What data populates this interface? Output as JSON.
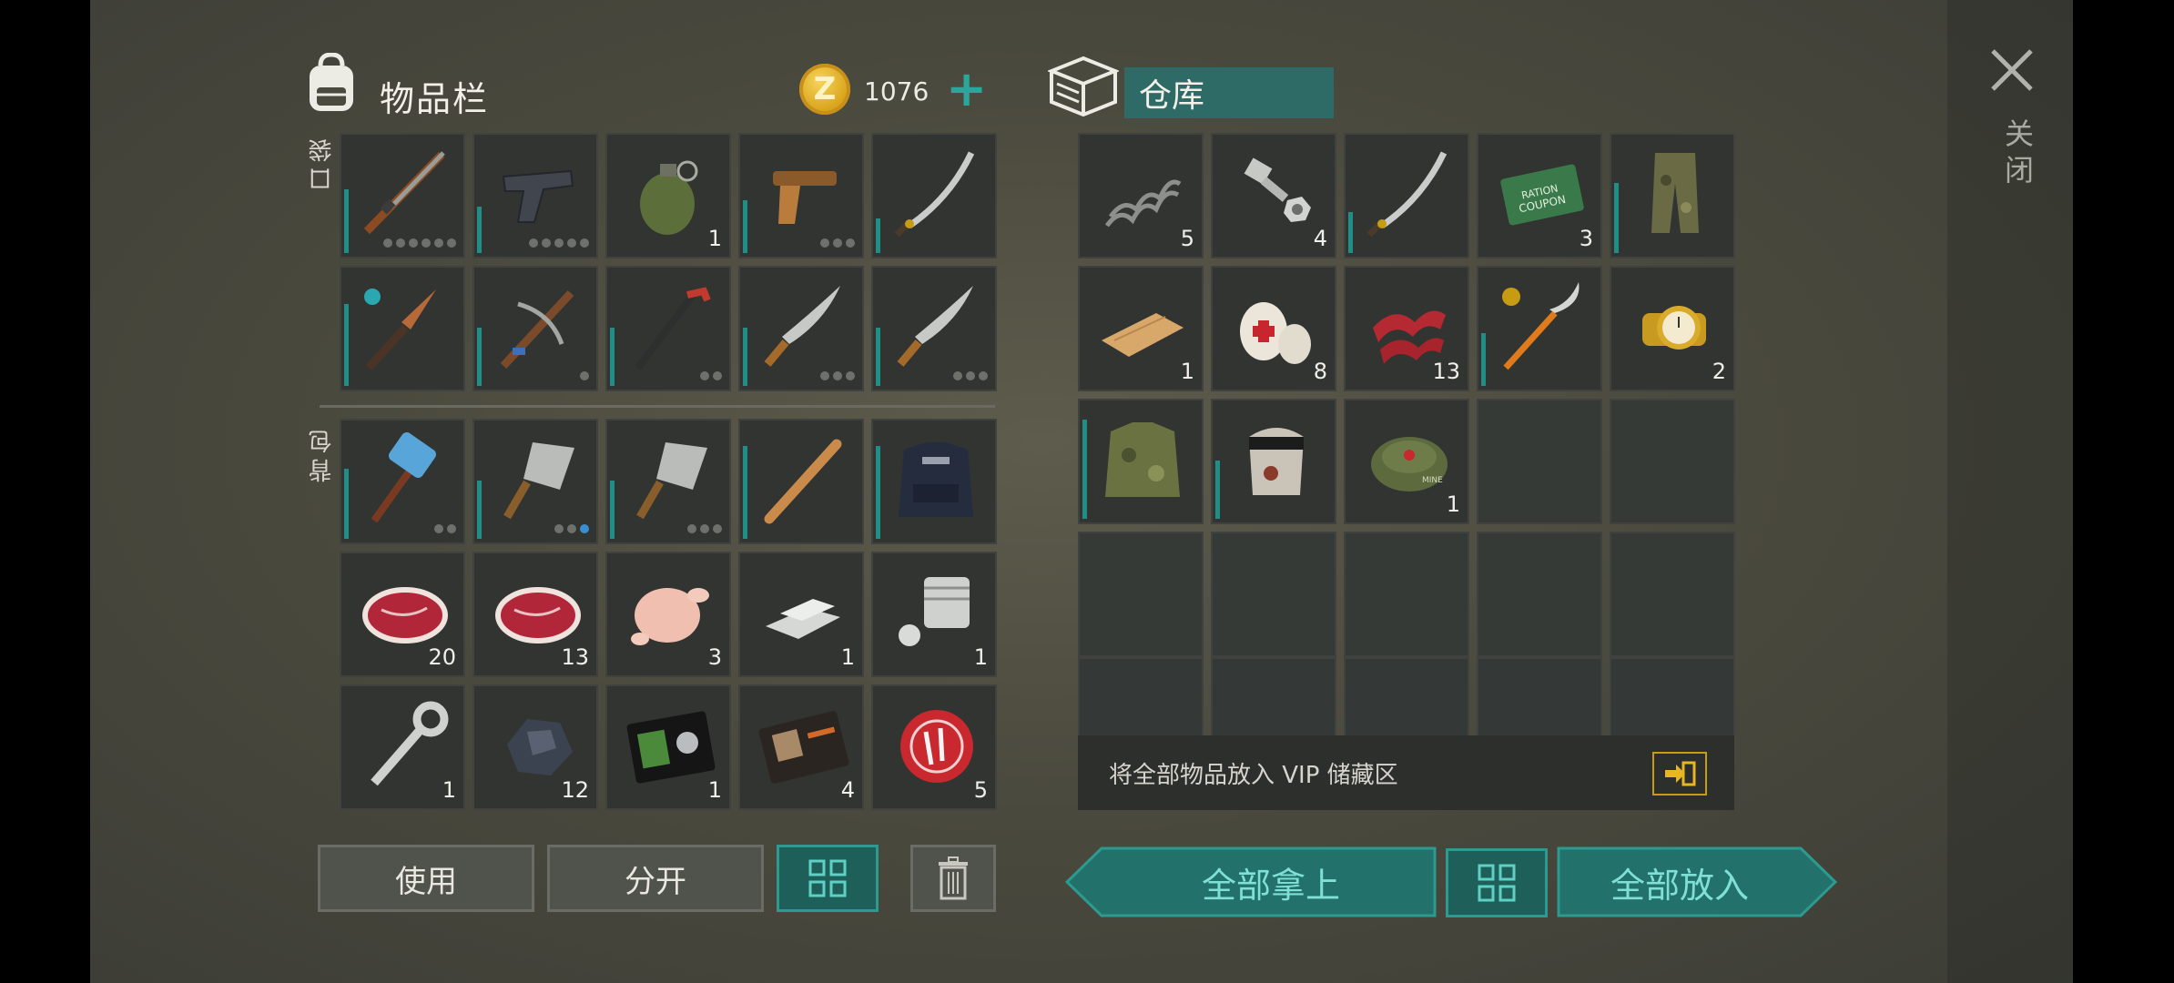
{
  "inventory": {
    "title": "物品栏",
    "coins": "1076",
    "pocket_label": "口袋",
    "backpack_label": "背包",
    "pocket_slots": [
      {
        "icon": "shotgun-icon",
        "durability": 0.55,
        "dots": 6,
        "qty": ""
      },
      {
        "icon": "pistol-icon",
        "durability": 0.4,
        "dots": 5,
        "qty": ""
      },
      {
        "icon": "grenade-icon",
        "durability": 0,
        "dots": 0,
        "qty": "1"
      },
      {
        "icon": "flare-gun-icon",
        "durability": 0.45,
        "dots": 3,
        "qty": ""
      },
      {
        "icon": "katana-icon",
        "durability": 0.3,
        "dots": 0,
        "qty": ""
      },
      {
        "icon": "combat-knife-icon",
        "durability": 0.7,
        "dots": 0,
        "qty": ""
      },
      {
        "icon": "crossbow-icon",
        "durability": 0.5,
        "dots": 1,
        "qty": ""
      },
      {
        "icon": "crowbar-icon",
        "durability": 0.5,
        "dots": 2,
        "qty": ""
      },
      {
        "icon": "machete-icon",
        "durability": 0.5,
        "dots": 3,
        "qty": ""
      },
      {
        "icon": "machete-icon",
        "durability": 0.5,
        "dots": 3,
        "qty": ""
      }
    ],
    "backpack_slots": [
      {
        "icon": "sledgehammer-icon",
        "durability": 0.6,
        "dots": 2,
        "qty": ""
      },
      {
        "icon": "cleaver-icon",
        "durability": 0.5,
        "dots": 3,
        "blue_dot": true,
        "qty": ""
      },
      {
        "icon": "cleaver-icon",
        "durability": 0.5,
        "dots": 3,
        "qty": ""
      },
      {
        "icon": "baseball-bat-icon",
        "durability": 0.8,
        "dots": 0,
        "qty": ""
      },
      {
        "icon": "police-vest-icon",
        "durability": 0.8,
        "dots": 0,
        "qty": ""
      },
      {
        "icon": "raw-steak-icon",
        "durability": 0,
        "dots": 0,
        "qty": "20"
      },
      {
        "icon": "raw-steak-icon",
        "durability": 0,
        "dots": 0,
        "qty": "13"
      },
      {
        "icon": "raw-chicken-icon",
        "durability": 0,
        "dots": 0,
        "qty": "3"
      },
      {
        "icon": "metal-bars-icon",
        "durability": 0,
        "dots": 0,
        "qty": "1"
      },
      {
        "icon": "engine-cylinder-icon",
        "durability": 0,
        "dots": 0,
        "qty": "1"
      },
      {
        "icon": "wrench-icon",
        "durability": 0,
        "dots": 0,
        "qty": "1"
      },
      {
        "icon": "coal-ore-icon",
        "durability": 0,
        "dots": 0,
        "qty": "12"
      },
      {
        "icon": "police-badge-wallet-icon",
        "durability": 0,
        "dots": 0,
        "qty": "1"
      },
      {
        "icon": "patrol-officer-id-icon",
        "durability": 0,
        "dots": 0,
        "qty": "4"
      },
      {
        "icon": "bottle-cap-icon",
        "durability": 0,
        "dots": 0,
        "qty": "5"
      }
    ],
    "buttons": {
      "use": "使用",
      "split": "分开"
    }
  },
  "storage": {
    "title": "仓库",
    "slots": [
      {
        "icon": "spring-icon",
        "durability": 0,
        "qty": "5"
      },
      {
        "icon": "bolt-nut-icon",
        "durability": 0,
        "qty": "4"
      },
      {
        "icon": "katana-icon",
        "durability": 0.35,
        "qty": ""
      },
      {
        "icon": "ration-coupon-icon",
        "durability": 0,
        "qty": "3",
        "text": "RATION COUPON"
      },
      {
        "icon": "camo-pants-icon",
        "durability": 0.6,
        "qty": ""
      },
      {
        "icon": "wood-plank-icon",
        "durability": 0,
        "qty": "1"
      },
      {
        "icon": "bandage-icon",
        "durability": 0,
        "qty": "8"
      },
      {
        "icon": "raw-bacon-icon",
        "durability": 0,
        "qty": "13"
      },
      {
        "icon": "flaming-glaive-icon",
        "durability": 0.45,
        "qty": ""
      },
      {
        "icon": "gold-watch-icon",
        "durability": 0,
        "qty": "2"
      },
      {
        "icon": "camo-jacket-icon",
        "durability": 0.85,
        "qty": ""
      },
      {
        "icon": "welding-mask-icon",
        "durability": 0.5,
        "qty": ""
      },
      {
        "icon": "landmine-icon",
        "durability": 0,
        "qty": "1",
        "text": "MINE"
      }
    ],
    "vip_text": "将全部物品放入 VIP 储藏区",
    "buttons": {
      "take_all": "全部拿上",
      "put_all": "全部放入"
    }
  },
  "close_label": "关闭",
  "colors": {
    "accent": "#2aa79a",
    "durability": "#1f8e86",
    "coin": "#d9a41c"
  }
}
